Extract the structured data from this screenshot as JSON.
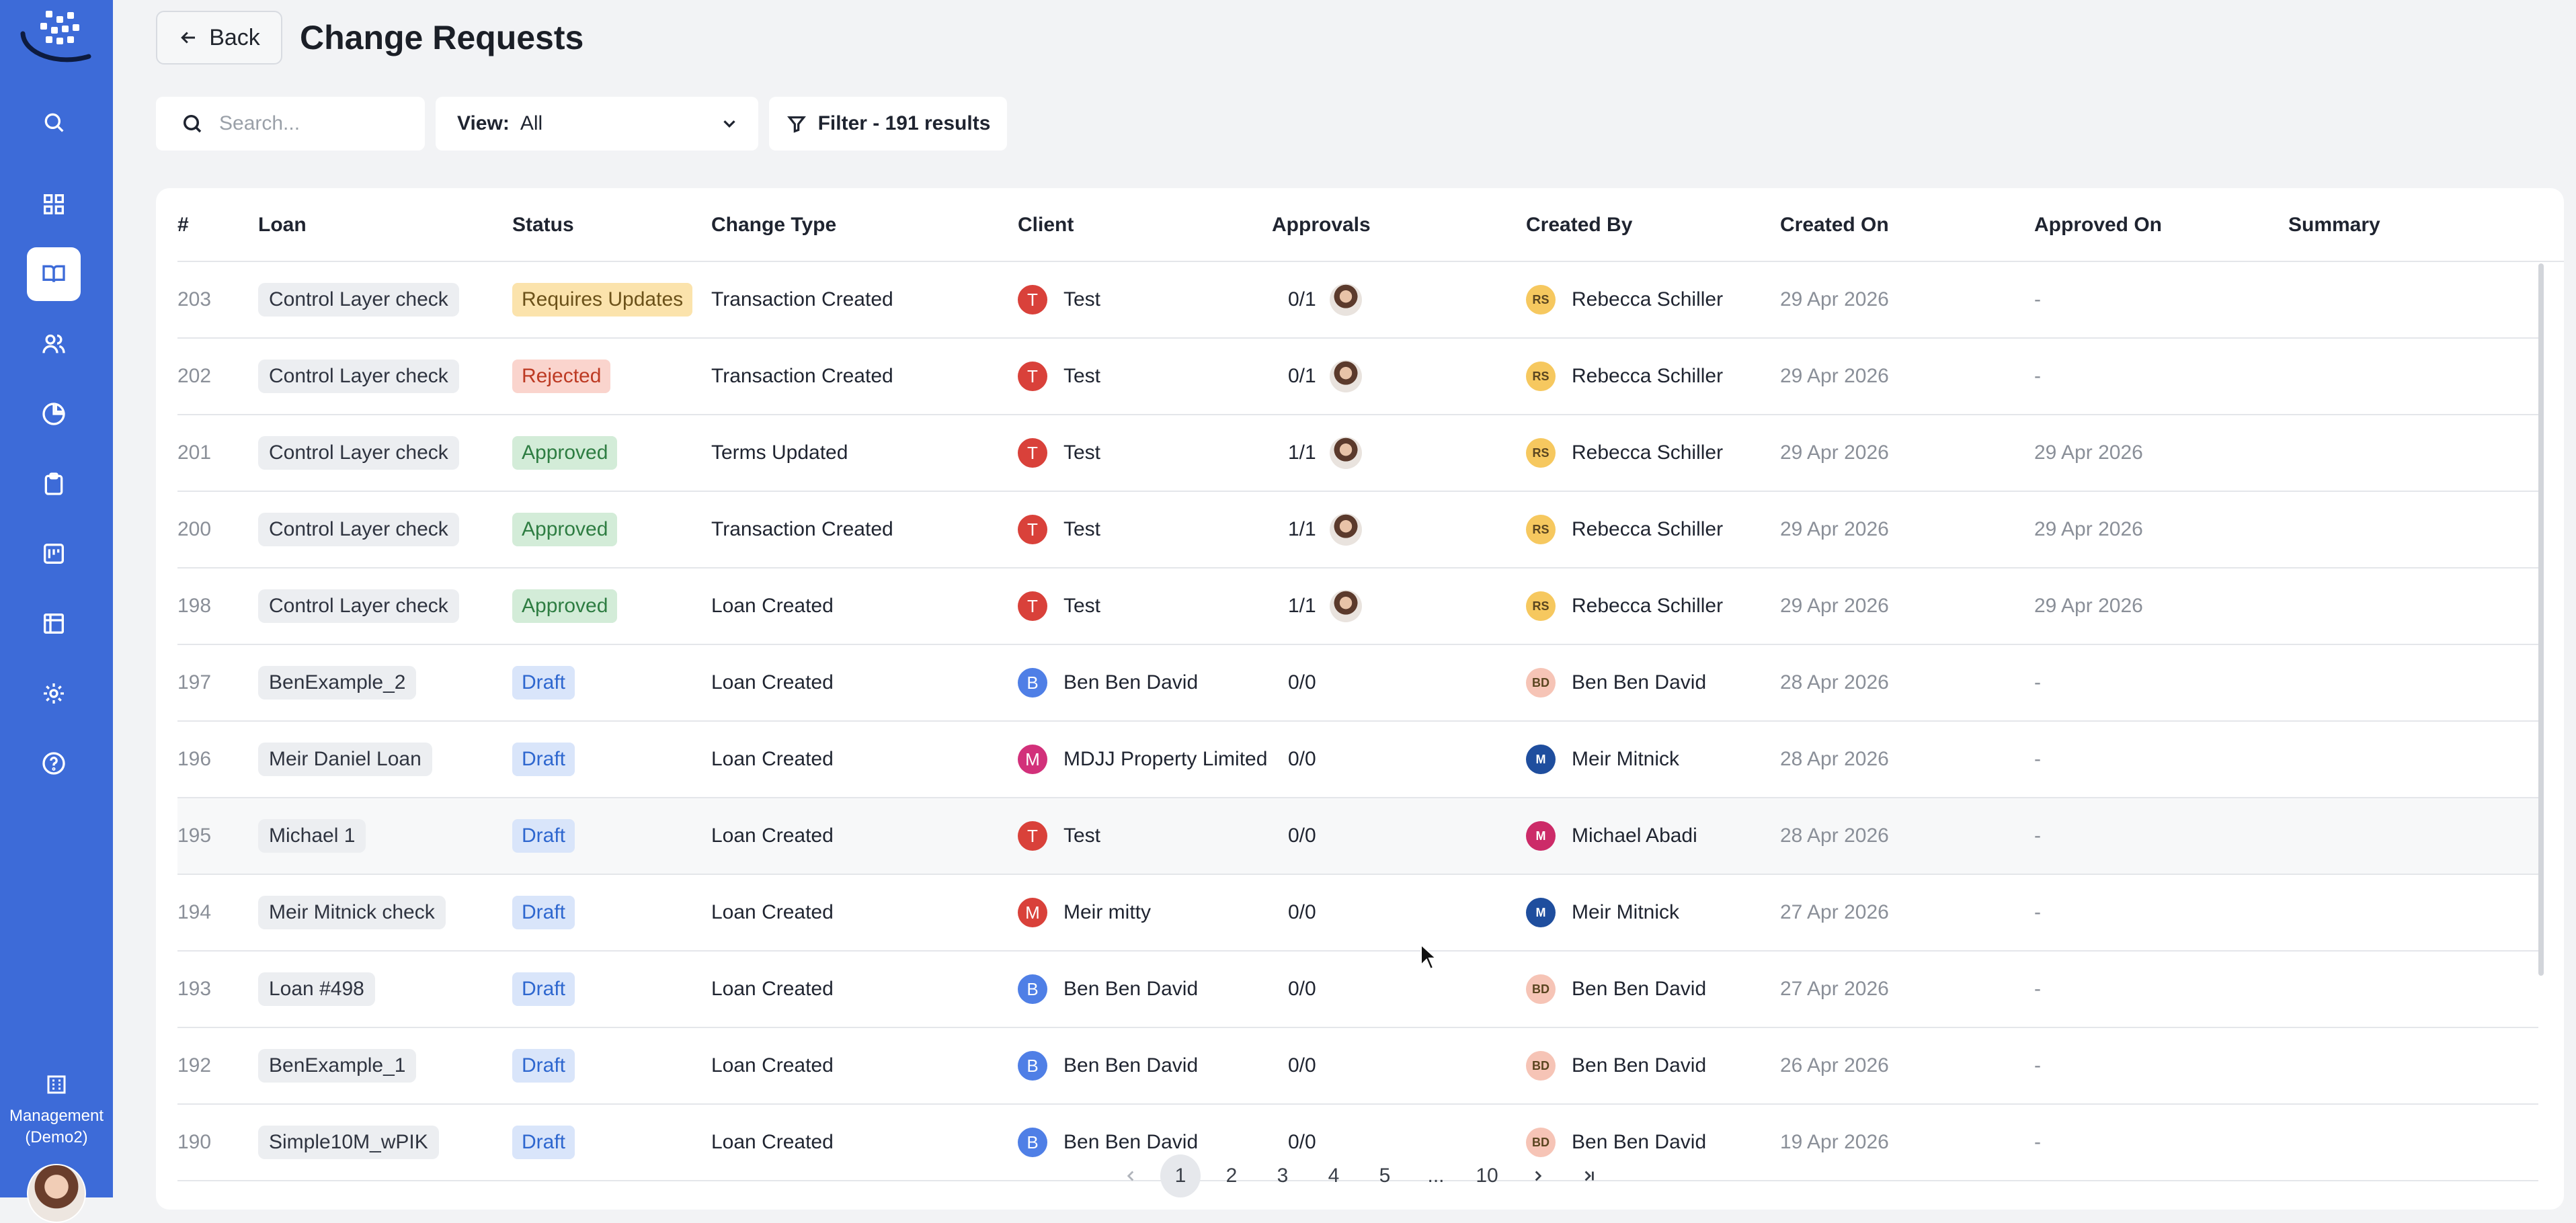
{
  "header": {
    "back_label": "Back",
    "title": "Change Requests"
  },
  "sidebar": {
    "items": [
      {
        "name": "search",
        "icon": "search-icon"
      },
      {
        "name": "dashboard",
        "icon": "grid-icon"
      },
      {
        "name": "loans",
        "icon": "book-open-icon",
        "active": true
      },
      {
        "name": "users",
        "icon": "users-icon"
      },
      {
        "name": "reports",
        "icon": "pie-chart-icon"
      },
      {
        "name": "tasks",
        "icon": "clipboard-icon"
      },
      {
        "name": "board",
        "icon": "kanban-icon"
      },
      {
        "name": "tables",
        "icon": "table-icon"
      },
      {
        "name": "settings",
        "icon": "gear-icon"
      },
      {
        "name": "help",
        "icon": "help-circle-icon"
      }
    ],
    "management_label": "Management",
    "management_sub": "(Demo2)"
  },
  "toolbar": {
    "search_placeholder": "Search...",
    "view_label": "View:",
    "view_value": "All",
    "filter_label": "Filter - 191 results"
  },
  "table": {
    "columns": [
      "#",
      "Loan",
      "Status",
      "Change Type",
      "Client",
      "Approvals",
      "Created By",
      "Created On",
      "Approved On",
      "Summary"
    ],
    "rows": [
      {
        "num": "203",
        "loan": "Control Layer check",
        "status": "Requires Updates",
        "status_kind": "req",
        "change": "Transaction Created",
        "client_initial": "T",
        "client": "Test",
        "client_color": "#d9413a",
        "approvals": "0/1",
        "approver_photo": true,
        "creator_initials": "RS",
        "creator": "Rebecca Schiller",
        "creator_bg": "#f6c85f",
        "created_on": "29 Apr 2026",
        "approved_on": "-"
      },
      {
        "num": "202",
        "loan": "Control Layer check",
        "status": "Rejected",
        "status_kind": "rej",
        "change": "Transaction Created",
        "client_initial": "T",
        "client": "Test",
        "client_color": "#d9413a",
        "approvals": "0/1",
        "approver_photo": true,
        "creator_initials": "RS",
        "creator": "Rebecca Schiller",
        "creator_bg": "#f6c85f",
        "created_on": "29 Apr 2026",
        "approved_on": "-"
      },
      {
        "num": "201",
        "loan": "Control Layer check",
        "status": "Approved",
        "status_kind": "app",
        "change": "Terms Updated",
        "client_initial": "T",
        "client": "Test",
        "client_color": "#d9413a",
        "approvals": "1/1",
        "approver_photo": true,
        "creator_initials": "RS",
        "creator": "Rebecca Schiller",
        "creator_bg": "#f6c85f",
        "created_on": "29 Apr 2026",
        "approved_on": "29 Apr 2026"
      },
      {
        "num": "200",
        "loan": "Control Layer check",
        "status": "Approved",
        "status_kind": "app",
        "change": "Transaction Created",
        "client_initial": "T",
        "client": "Test",
        "client_color": "#d9413a",
        "approvals": "1/1",
        "approver_photo": true,
        "creator_initials": "RS",
        "creator": "Rebecca Schiller",
        "creator_bg": "#f6c85f",
        "created_on": "29 Apr 2026",
        "approved_on": "29 Apr 2026"
      },
      {
        "num": "198",
        "loan": "Control Layer check",
        "status": "Approved",
        "status_kind": "app",
        "change": "Loan Created",
        "client_initial": "T",
        "client": "Test",
        "client_color": "#d9413a",
        "approvals": "1/1",
        "approver_photo": true,
        "creator_initials": "RS",
        "creator": "Rebecca Schiller",
        "creator_bg": "#f6c85f",
        "created_on": "29 Apr 2026",
        "approved_on": "29 Apr 2026"
      },
      {
        "num": "197",
        "loan": "BenExample_2",
        "status": "Draft",
        "status_kind": "draft",
        "change": "Loan Created",
        "client_initial": "B",
        "client": "Ben Ben David",
        "client_color": "#4f7fe6",
        "approvals": "0/0",
        "approver_photo": false,
        "creator_initials": "BD",
        "creator": "Ben Ben David",
        "creator_bg": "#f6c4b6",
        "created_on": "28 Apr 2026",
        "approved_on": "-"
      },
      {
        "num": "196",
        "loan": "Meir Daniel Loan",
        "status": "Draft",
        "status_kind": "draft",
        "change": "Loan Created",
        "client_initial": "M",
        "client": "MDJJ Property Limited",
        "client_color": "#d2307a",
        "approvals": "0/0",
        "approver_photo": false,
        "creator_initials": "M",
        "creator": "Meir Mitnick",
        "creator_bg": "#1f4e9e",
        "created_on": "28 Apr 2026",
        "approved_on": "-"
      },
      {
        "num": "195",
        "loan": "Michael 1",
        "status": "Draft",
        "status_kind": "draft",
        "change": "Loan Created",
        "client_initial": "T",
        "client": "Test",
        "client_color": "#d9413a",
        "approvals": "0/0",
        "approver_photo": false,
        "creator_initials": "M",
        "creator": "Michael Abadi",
        "creator_bg": "#cc2b68",
        "created_on": "28 Apr 2026",
        "approved_on": "-"
      },
      {
        "num": "194",
        "loan": "Meir Mitnick check",
        "status": "Draft",
        "status_kind": "draft",
        "change": "Loan Created",
        "client_initial": "M",
        "client": "Meir mitty",
        "client_color": "#d9413a",
        "approvals": "0/0",
        "approver_photo": false,
        "creator_initials": "M",
        "creator": "Meir Mitnick",
        "creator_bg": "#1f4e9e",
        "created_on": "27 Apr 2026",
        "approved_on": "-"
      },
      {
        "num": "193",
        "loan": "Loan #498",
        "status": "Draft",
        "status_kind": "draft",
        "change": "Loan Created",
        "client_initial": "B",
        "client": "Ben Ben David",
        "client_color": "#4f7fe6",
        "approvals": "0/0",
        "approver_photo": false,
        "creator_initials": "BD",
        "creator": "Ben Ben David",
        "creator_bg": "#f6c4b6",
        "created_on": "27 Apr 2026",
        "approved_on": "-"
      },
      {
        "num": "192",
        "loan": "BenExample_1",
        "status": "Draft",
        "status_kind": "draft",
        "change": "Loan Created",
        "client_initial": "B",
        "client": "Ben Ben David",
        "client_color": "#4f7fe6",
        "approvals": "0/0",
        "approver_photo": false,
        "creator_initials": "BD",
        "creator": "Ben Ben David",
        "creator_bg": "#f6c4b6",
        "created_on": "26 Apr 2026",
        "approved_on": "-"
      },
      {
        "num": "190",
        "loan": "Simple10M_wPIK",
        "status": "Draft",
        "status_kind": "draft",
        "change": "Loan Created",
        "client_initial": "B",
        "client": "Ben Ben David",
        "client_color": "#4f7fe6",
        "approvals": "0/0",
        "approver_photo": false,
        "creator_initials": "BD",
        "creator": "Ben Ben David",
        "creator_bg": "#f6c4b6",
        "created_on": "19 Apr 2026",
        "approved_on": "-"
      }
    ]
  },
  "pagination": {
    "pages": [
      "1",
      "2",
      "3",
      "4",
      "5",
      "...",
      "10"
    ],
    "current": "1"
  }
}
